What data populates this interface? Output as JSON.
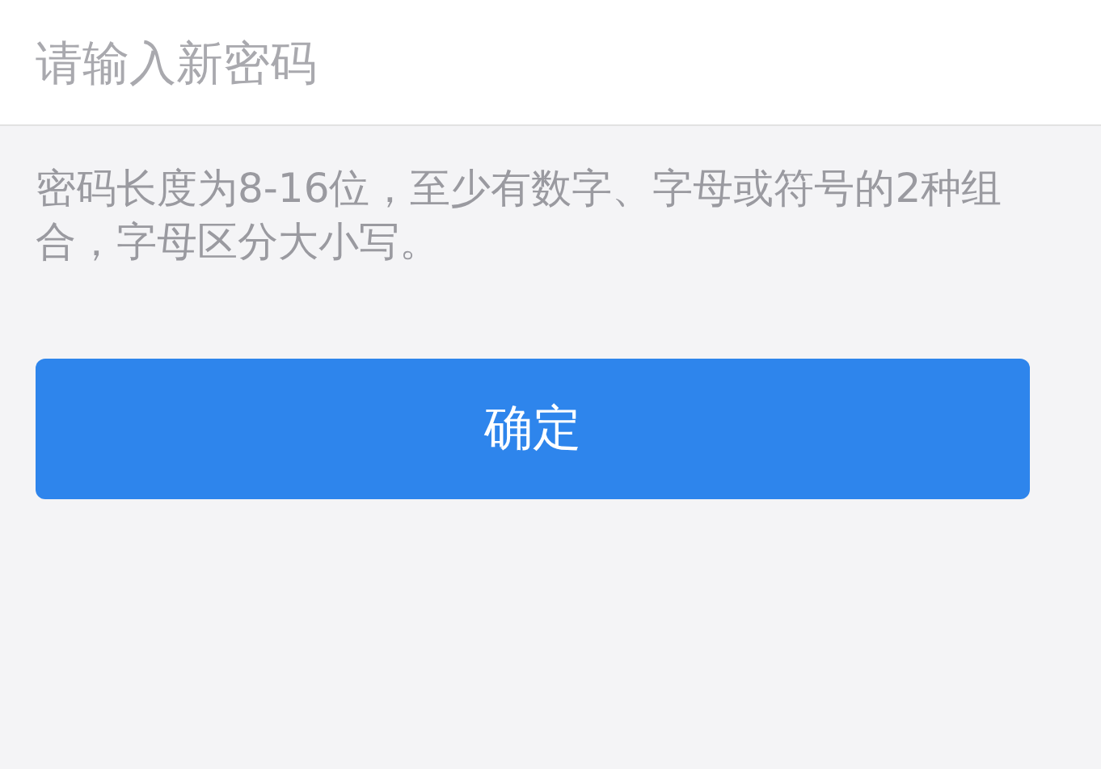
{
  "password_field": {
    "placeholder": "请输入新密码"
  },
  "hint": "密码长度为8-16位，至少有数字、字母或符号的2种组合，字母区分大小写。",
  "buttons": [
    {
      "label": "确定",
      "kind": "primary"
    }
  ]
}
